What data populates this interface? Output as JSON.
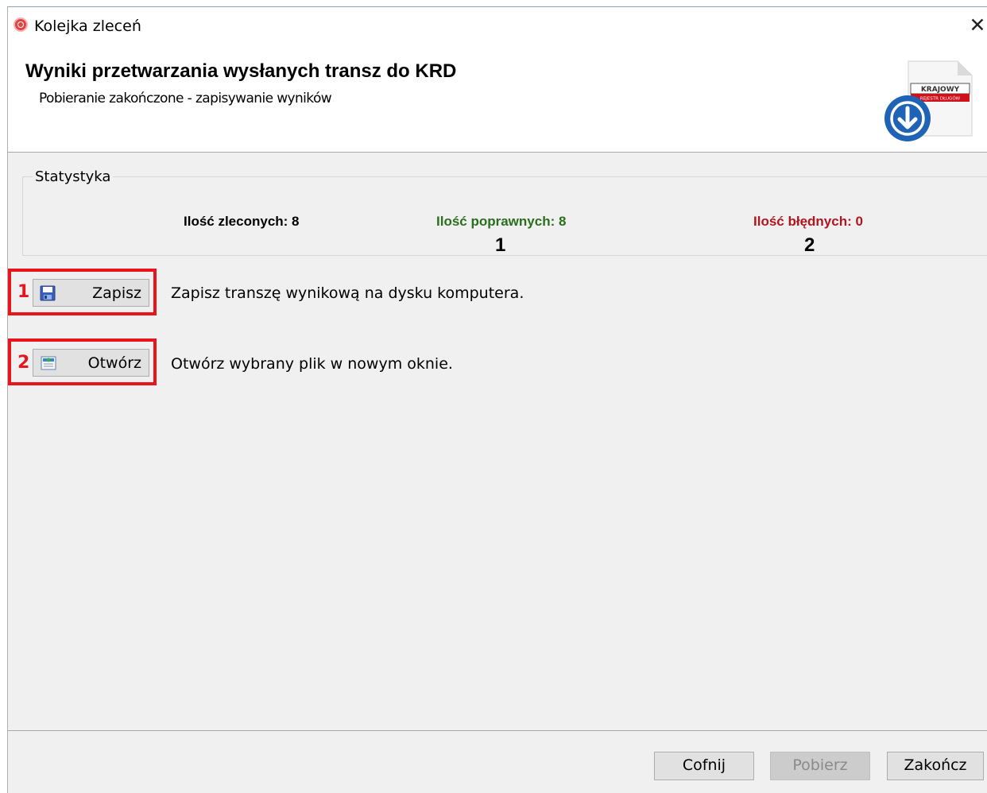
{
  "window": {
    "title": "Kolejka zleceń"
  },
  "header": {
    "title": "Wyniki przetwarzania wysłanych transz do KRD",
    "subtitle": "Pobieranie zakończone - zapisywanie wyników",
    "logo_text_top": "KRAJOWY",
    "logo_text_bottom": "REJESTR DŁUGÓW"
  },
  "stats": {
    "legend": "Statystyka",
    "ordered_label": "Ilość zleconych: 8",
    "correct_label": "Ilość poprawnych: 8",
    "errors_label": "Ilość błędnych: 0",
    "marker_1": "1",
    "marker_2": "2",
    "colors": {
      "correct": "#2a6e1e",
      "errors": "#b0161d"
    }
  },
  "actions": [
    {
      "marker": "1",
      "button": "Zapisz",
      "icon": "floppy-disk-icon",
      "description": "Zapisz transzę wynikową na dysku komputera."
    },
    {
      "marker": "2",
      "button": "Otwórz",
      "icon": "open-file-icon",
      "description": "Otwórz wybrany plik w nowym oknie."
    }
  ],
  "footer": {
    "back": "Cofnij",
    "download": "Pobierz",
    "finish": "Zakończ"
  },
  "highlight_color": "#e8151d"
}
